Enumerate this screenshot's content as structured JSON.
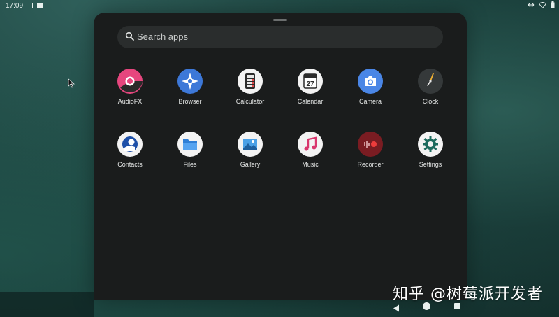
{
  "status_bar": {
    "time": "17:09"
  },
  "search": {
    "placeholder": "Search apps"
  },
  "apps": [
    {
      "label": "AudioFX",
      "icon": "audiofx-icon"
    },
    {
      "label": "Browser",
      "icon": "browser-icon"
    },
    {
      "label": "Calculator",
      "icon": "calculator-icon"
    },
    {
      "label": "Calendar",
      "icon": "calendar-icon",
      "badge": "27"
    },
    {
      "label": "Camera",
      "icon": "camera-icon"
    },
    {
      "label": "Clock",
      "icon": "clock-icon"
    },
    {
      "label": "Contacts",
      "icon": "contacts-icon"
    },
    {
      "label": "Files",
      "icon": "files-icon"
    },
    {
      "label": "Gallery",
      "icon": "gallery-icon"
    },
    {
      "label": "Music",
      "icon": "music-icon"
    },
    {
      "label": "Recorder",
      "icon": "recorder-icon"
    },
    {
      "label": "Settings",
      "icon": "settings-icon"
    }
  ],
  "watermark": "知乎 @树莓派开发者",
  "colors": {
    "drawer_bg": "#1a1c1c",
    "search_bg": "#2a2d2d",
    "wallpaper": "#1f4742"
  }
}
